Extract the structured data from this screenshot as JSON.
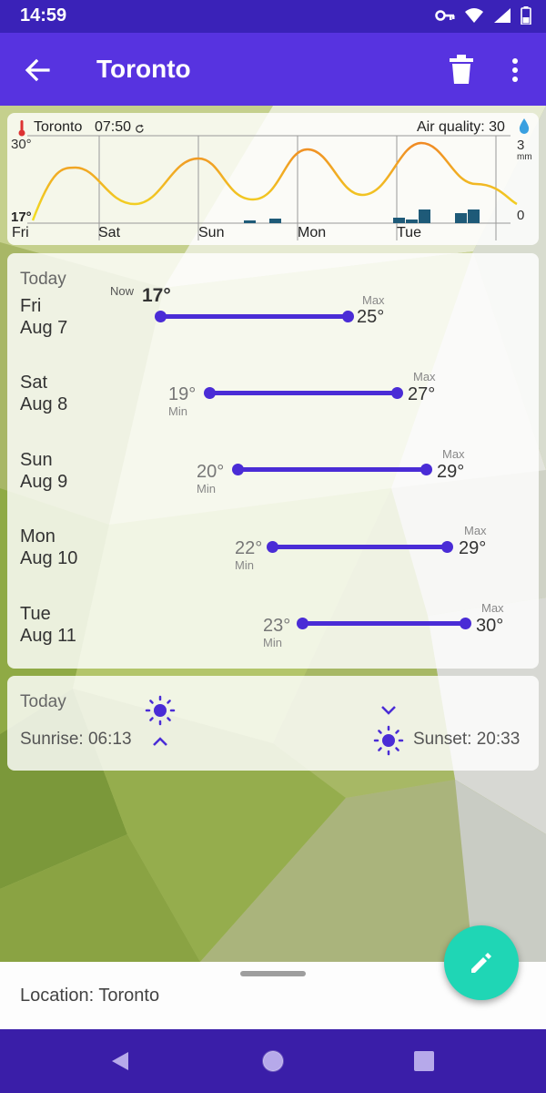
{
  "status": {
    "time": "14:59"
  },
  "appbar": {
    "title": "Toronto"
  },
  "chart": {
    "location": "Toronto",
    "update_time": "07:50",
    "air_quality": "Air quality: 30",
    "y_top": "30°",
    "y_bottom": "17°",
    "rain_top": "3",
    "rain_unit": "mm",
    "rain_bottom": "0",
    "days": [
      "Fri",
      "Sat",
      "Sun",
      "Mon",
      "Tue"
    ]
  },
  "daily": {
    "today_label": "Today",
    "now_label": "Now",
    "now_temp": "17°",
    "min_label": "Min",
    "max_label": "Max",
    "days": [
      {
        "day": "Fri",
        "date": "Aug 7",
        "min": "17°",
        "max": "25°"
      },
      {
        "day": "Sat",
        "date": "Aug 8",
        "min": "19°",
        "max": "27°"
      },
      {
        "day": "Sun",
        "date": "Aug 9",
        "min": "20°",
        "max": "29°"
      },
      {
        "day": "Mon",
        "date": "Aug 10",
        "min": "22°",
        "max": "29°"
      },
      {
        "day": "Tue",
        "date": "Aug 11",
        "min": "23°",
        "max": "30°"
      }
    ]
  },
  "sun": {
    "today_label": "Today",
    "sunrise": "Sunrise: 06:13",
    "sunset": "Sunset: 20:33"
  },
  "bottom": {
    "location": "Location: Toronto"
  },
  "colors": {
    "accent": "#5733e0",
    "bar": "#4a2cd6",
    "fab": "#1fd6b5",
    "rain": "#1e5a78"
  }
}
